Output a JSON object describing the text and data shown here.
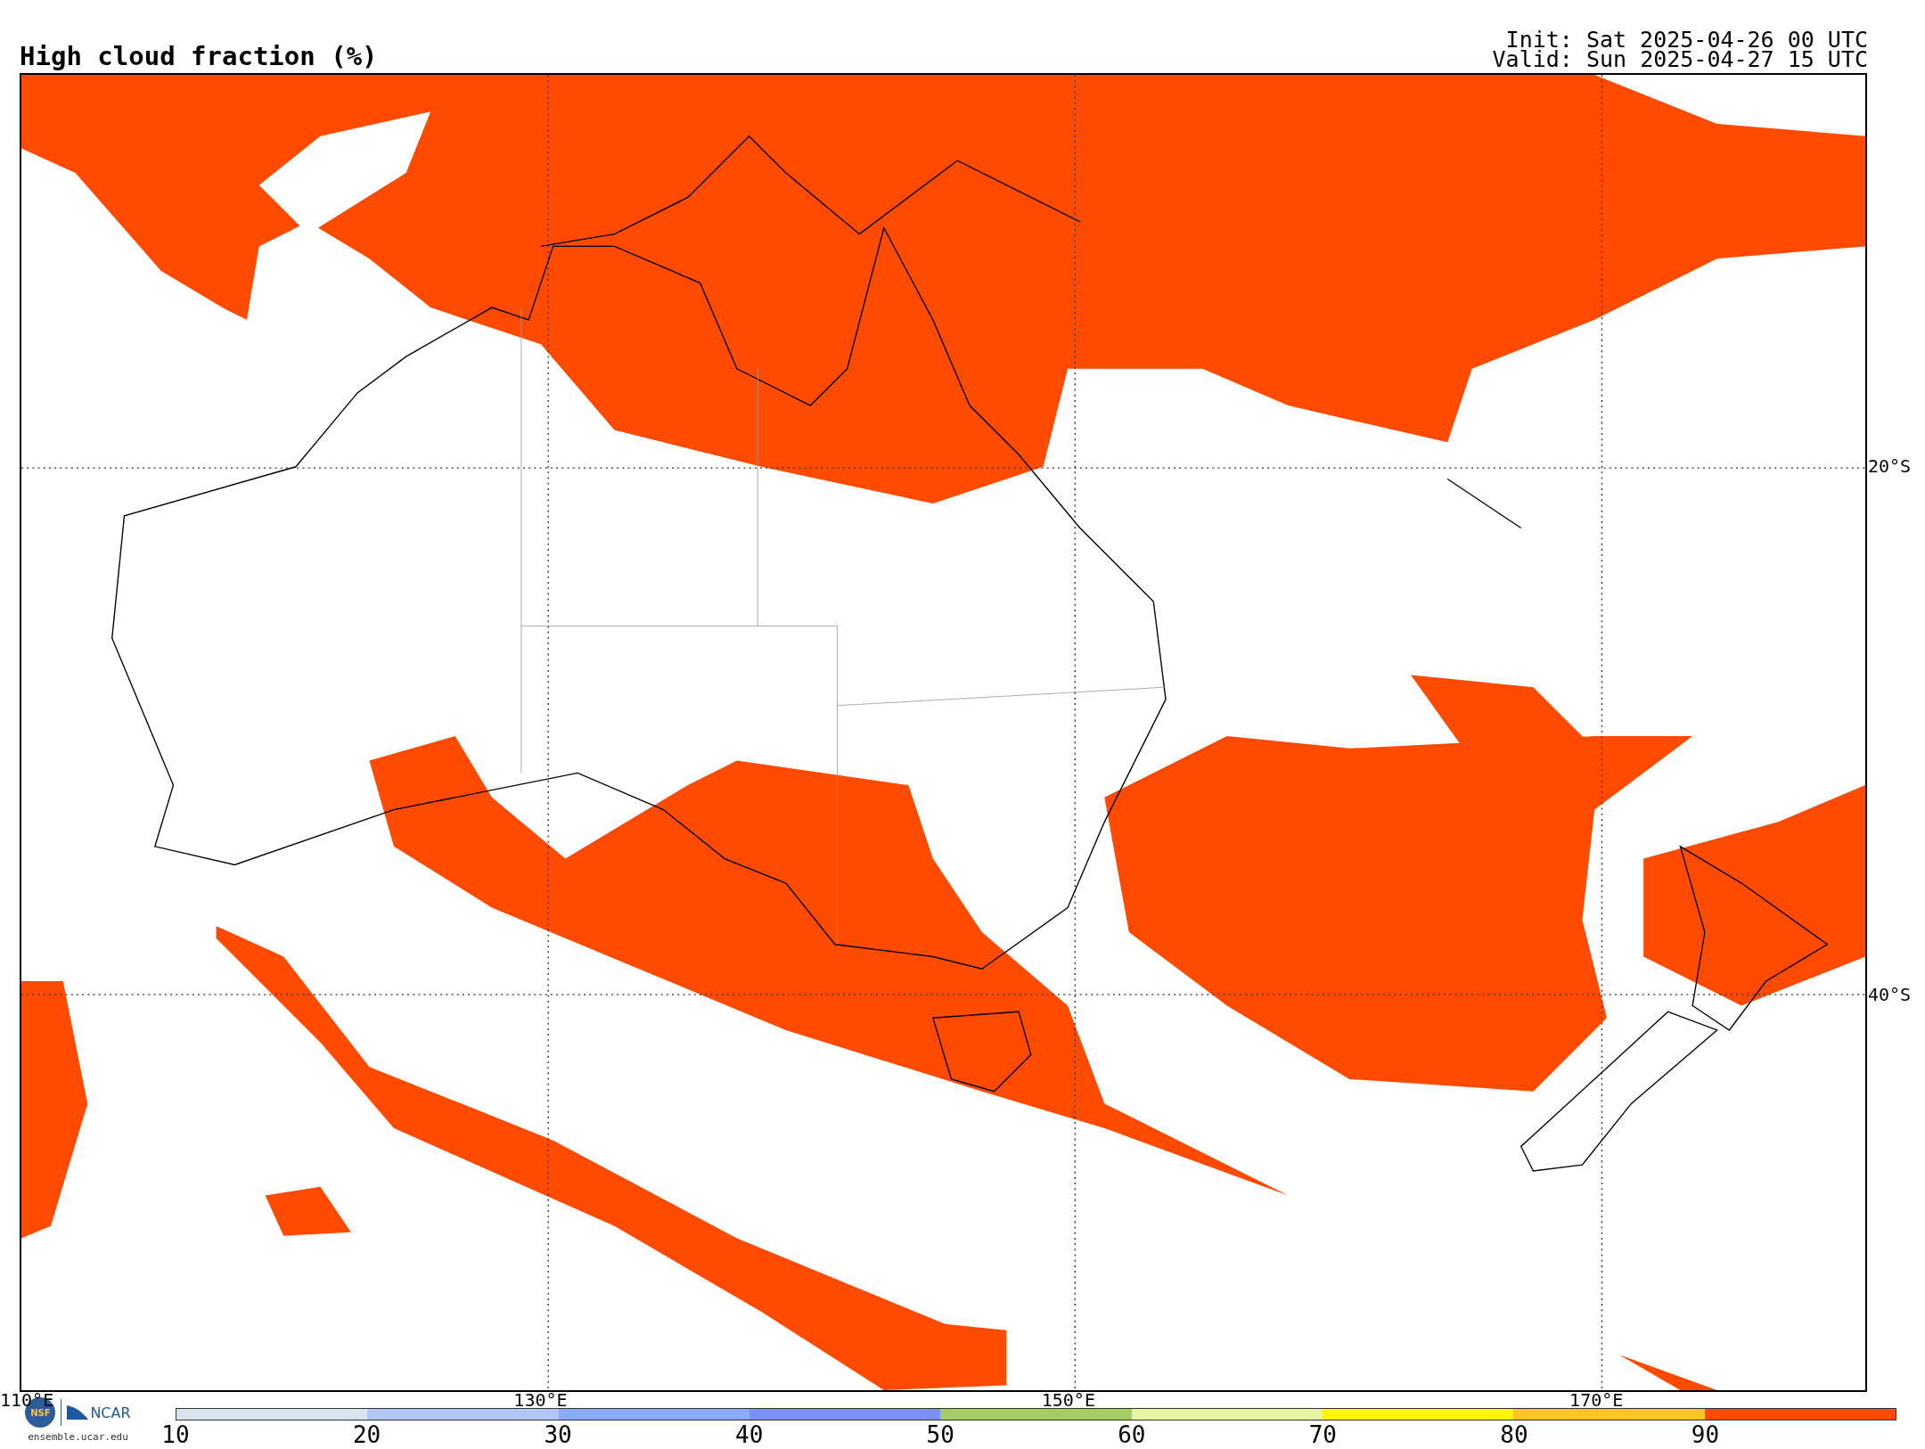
{
  "title": "High cloud fraction (%)",
  "run": {
    "init": "Init: Sat 2025-04-26 00 UTC",
    "valid": "Valid: Sun 2025-04-27 15 UTC"
  },
  "map": {
    "lon_labels": [
      "110°E",
      "130°E",
      "150°E",
      "170°E"
    ],
    "lat_labels": [
      "20°S",
      "40°S"
    ]
  },
  "legend": {
    "bins": [
      {
        "color": "#d9e5ec"
      },
      {
        "color": "#b4c8f8"
      },
      {
        "color": "#8aacf8"
      },
      {
        "color": "#7b8ff8"
      },
      {
        "color": "#a6cd63"
      },
      {
        "color": "#e8f5a5"
      },
      {
        "color": "#fff50a"
      },
      {
        "color": "#fcc522"
      },
      {
        "color": "#ff4a00"
      }
    ],
    "ticks": [
      "10",
      "20",
      "30",
      "40",
      "50",
      "60",
      "70",
      "80",
      "90"
    ]
  },
  "logos": {
    "nsf": "NSF",
    "ncar": "NCAR",
    "url": "ensemble.ucar.edu"
  }
}
